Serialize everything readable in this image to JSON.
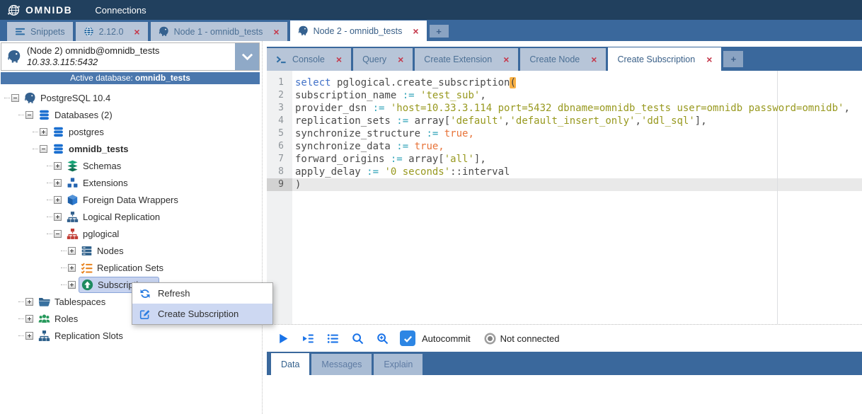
{
  "topbar": {
    "logo_text": "OMNIDB",
    "connections_label": "Connections"
  },
  "colors": {
    "topbar": "#21405e",
    "tab_strip": "#3a689c",
    "accent_blue": "#2d86e4",
    "close_red": "#c5384b",
    "selection": "#c7d3ef",
    "active_db_bar": "#4a77ad"
  },
  "outer_tabs": [
    {
      "label": "Snippets",
      "icon": "snippets",
      "closable": false,
      "active": false
    },
    {
      "label": "2.12.0",
      "icon": "globe",
      "closable": true,
      "active": false
    },
    {
      "label": "Node 1 - omnidb_tests",
      "icon": "postgres",
      "closable": true,
      "active": false
    },
    {
      "label": "Node 2 - omnidb_tests",
      "icon": "postgres",
      "closable": true,
      "active": true
    },
    {
      "label": "+",
      "add": true
    }
  ],
  "sidebar": {
    "connection": {
      "title": "(Node 2) omnidb@omnidb_tests",
      "host": "10.33.3.115:5432"
    },
    "active_db": {
      "label": "Active database:",
      "value": "omnidb_tests"
    },
    "tree": [
      {
        "label": "PostgreSQL 10.4",
        "icon": "postgres",
        "level": 0,
        "expander": "minus"
      },
      {
        "label": "Databases (2)",
        "icon": "database",
        "level": 1,
        "expander": "minus"
      },
      {
        "label": "postgres",
        "icon": "database",
        "level": 2,
        "expander": "plus"
      },
      {
        "label": "omnidb_tests",
        "icon": "database",
        "level": 2,
        "expander": "minus",
        "bold": true
      },
      {
        "label": "Schemas",
        "icon": "schemas",
        "level": 3,
        "expander": "plus"
      },
      {
        "label": "Extensions",
        "icon": "extensions",
        "level": 3,
        "expander": "plus"
      },
      {
        "label": "Foreign Data Wrappers",
        "icon": "fdw",
        "level": 3,
        "expander": "plus"
      },
      {
        "label": "Logical Replication",
        "icon": "sitemap-blue",
        "level": 3,
        "expander": "plus"
      },
      {
        "label": "pglogical",
        "icon": "sitemap-red",
        "level": 3,
        "expander": "minus"
      },
      {
        "label": "Nodes",
        "icon": "nodes",
        "level": 4,
        "expander": "plus"
      },
      {
        "label": "Replication Sets",
        "icon": "replication-sets",
        "level": 4,
        "expander": "plus"
      },
      {
        "label": "Subscriptions",
        "icon": "subscriptions",
        "level": 4,
        "expander": "plus",
        "selected": true
      },
      {
        "label": "Tablespaces",
        "icon": "folder",
        "level": 1,
        "expander": "plus"
      },
      {
        "label": "Roles",
        "icon": "roles",
        "level": 1,
        "expander": "plus"
      },
      {
        "label": "Replication Slots",
        "icon": "sitemap-navy",
        "level": 1,
        "expander": "plus"
      }
    ]
  },
  "context_menu": {
    "items": [
      {
        "label": "Refresh",
        "icon": "refresh",
        "highlighted": false
      },
      {
        "label": "Create Subscription",
        "icon": "edit",
        "highlighted": true
      }
    ]
  },
  "inner_tabs": [
    {
      "label": "Console",
      "icon": "console",
      "closable": true,
      "active": false
    },
    {
      "label": "Query",
      "closable": true,
      "active": false
    },
    {
      "label": "Create Extension",
      "closable": true,
      "active": false
    },
    {
      "label": "Create Node",
      "closable": true,
      "active": false
    },
    {
      "label": "Create Subscription",
      "closable": true,
      "active": true
    },
    {
      "label": "+",
      "add": true
    }
  ],
  "editor": {
    "line_count": 9,
    "active_line": 9,
    "lines": [
      [
        {
          "t": "select",
          "c": "kw"
        },
        {
          "t": " pglogical.create_subscription",
          "c": "pl"
        },
        {
          "t": "(",
          "c": "hl"
        }
      ],
      [
        {
          "t": "subscription_name ",
          "c": "pl"
        },
        {
          "t": ":=",
          "c": "op"
        },
        {
          "t": " ",
          "c": "pl"
        },
        {
          "t": "'test_sub'",
          "c": "str"
        },
        {
          "t": ",",
          "c": "pl"
        }
      ],
      [
        {
          "t": "provider_dsn ",
          "c": "pl"
        },
        {
          "t": ":=",
          "c": "op"
        },
        {
          "t": " ",
          "c": "pl"
        },
        {
          "t": "'host=10.33.3.114 port=5432 dbname=omnidb_tests user=omnidb password=omnidb'",
          "c": "str"
        },
        {
          "t": ",",
          "c": "pl"
        }
      ],
      [
        {
          "t": "replication_sets ",
          "c": "pl"
        },
        {
          "t": ":=",
          "c": "op"
        },
        {
          "t": " array[",
          "c": "pl"
        },
        {
          "t": "'default'",
          "c": "str"
        },
        {
          "t": ",",
          "c": "pl"
        },
        {
          "t": "'default_insert_only'",
          "c": "str"
        },
        {
          "t": ",",
          "c": "pl"
        },
        {
          "t": "'ddl_sql'",
          "c": "str"
        },
        {
          "t": "],",
          "c": "pl"
        }
      ],
      [
        {
          "t": "synchronize_structure ",
          "c": "pl"
        },
        {
          "t": ":=",
          "c": "op"
        },
        {
          "t": " ",
          "c": "pl"
        },
        {
          "t": "true,",
          "c": "bool"
        }
      ],
      [
        {
          "t": "synchronize_data ",
          "c": "pl"
        },
        {
          "t": ":=",
          "c": "op"
        },
        {
          "t": " ",
          "c": "pl"
        },
        {
          "t": "true,",
          "c": "bool"
        }
      ],
      [
        {
          "t": "forward_origins ",
          "c": "pl"
        },
        {
          "t": ":=",
          "c": "op"
        },
        {
          "t": " array[",
          "c": "pl"
        },
        {
          "t": "'all'",
          "c": "str"
        },
        {
          "t": "],",
          "c": "pl"
        }
      ],
      [
        {
          "t": "apply_delay ",
          "c": "pl"
        },
        {
          "t": ":=",
          "c": "op"
        },
        {
          "t": " ",
          "c": "pl"
        },
        {
          "t": "'0 seconds'",
          "c": "str"
        },
        {
          "t": "::interval",
          "c": "pl"
        }
      ],
      [
        {
          "t": ")",
          "c": "pl"
        }
      ]
    ]
  },
  "toolbar": {
    "autocommit_label": "Autocommit",
    "status_label": "Not connected"
  },
  "bottom_tabs": [
    {
      "label": "Data",
      "active": true
    },
    {
      "label": "Messages",
      "active": false
    },
    {
      "label": "Explain",
      "active": false
    }
  ]
}
